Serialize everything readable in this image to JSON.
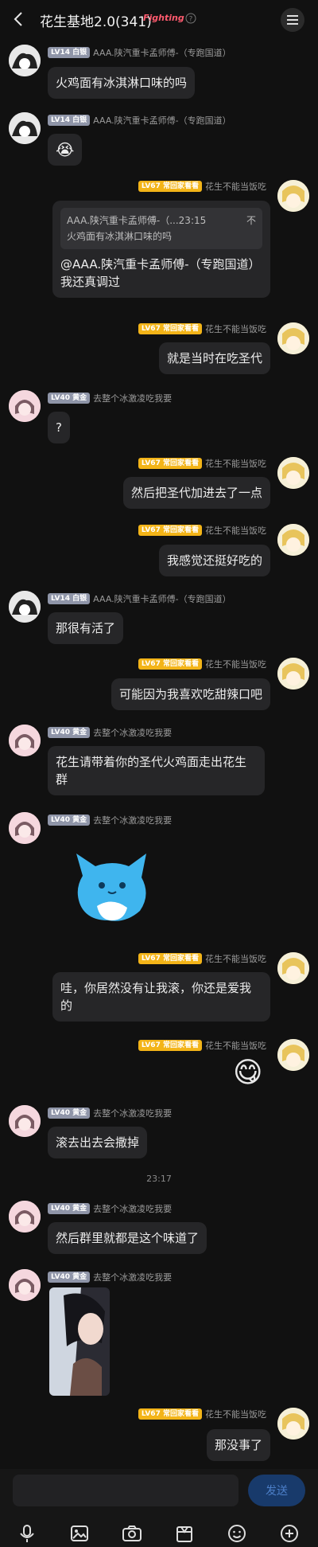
{
  "header": {
    "title": "花生基地2.0(341)",
    "tag": "Fighting"
  },
  "messages": [
    {
      "id": "m1",
      "side": "left",
      "level": "LV14",
      "rank": "白银",
      "nick": "AAA.陕汽重卡孟师傅-（专跑国道）",
      "text": "火鸡面有冰淇淋口味的吗"
    },
    {
      "id": "m2",
      "side": "left",
      "level": "LV14",
      "rank": "白银",
      "nick": "AAA.陕汽重卡孟师傅-（专跑国道）",
      "emoji": "😭"
    },
    {
      "id": "m3",
      "side": "right",
      "level": "LV67",
      "rank": "常回家看看",
      "nick": "花生不能当饭吃",
      "quote": {
        "head": "AAA.陕汽重卡孟师傅-（...23:15",
        "tail": "不",
        "body": "火鸡面有冰淇淋口味的吗"
      },
      "text": "@AAA.陕汽重卡孟师傅-（专跑国道） 我还真调过"
    },
    {
      "id": "m4",
      "side": "right",
      "level": "LV67",
      "rank": "常回家看看",
      "nick": "花生不能当饭吃",
      "text": "就是当时在吃圣代"
    },
    {
      "id": "m5",
      "side": "left",
      "level": "LV40",
      "rank": "黄金",
      "nick": "去整个冰激凌吃我要",
      "text": "?"
    },
    {
      "id": "m6",
      "side": "right",
      "level": "LV67",
      "rank": "常回家看看",
      "nick": "花生不能当饭吃",
      "text": "然后把圣代加进去了一点"
    },
    {
      "id": "m7",
      "side": "right",
      "level": "LV67",
      "rank": "常回家看看",
      "nick": "花生不能当饭吃",
      "text": "我感觉还挺好吃的"
    },
    {
      "id": "m8",
      "side": "left",
      "level": "LV14",
      "rank": "白银",
      "nick": "AAA.陕汽重卡孟师傅-（专跑国道）",
      "text": "那很有活了"
    },
    {
      "id": "m9",
      "side": "right",
      "level": "LV67",
      "rank": "常回家看看",
      "nick": "花生不能当饭吃",
      "text": "可能因为我喜欢吃甜辣口吧"
    },
    {
      "id": "m10",
      "side": "left",
      "level": "LV40",
      "rank": "黄金",
      "nick": "去整个冰激凌吃我要",
      "text": "花生请带着你的圣代火鸡面走出花生群"
    },
    {
      "id": "m11",
      "side": "left",
      "level": "LV40",
      "rank": "黄金",
      "nick": "去整个冰激凌吃我要",
      "sticker": "blue-cat-sticker"
    },
    {
      "id": "m12",
      "side": "right",
      "level": "LV67",
      "rank": "常回家看看",
      "nick": "花生不能当饭吃",
      "text": "哇，你居然没有让我滚，你还是爱我的"
    },
    {
      "id": "m13",
      "side": "right",
      "level": "LV67",
      "rank": "常回家看看",
      "nick": "花生不能当饭吃",
      "emoji": "😋"
    },
    {
      "id": "m14",
      "side": "left",
      "level": "LV40",
      "rank": "黄金",
      "nick": "去整个冰激凌吃我要",
      "text": "滚去出去会撒掉"
    },
    {
      "id": "m15",
      "side": "left",
      "level": "LV40",
      "rank": "黄金",
      "nick": "去整个冰激凌吃我要",
      "text": "然后群里就都是这个味道了"
    },
    {
      "id": "m16",
      "side": "left",
      "level": "LV40",
      "rank": "黄金",
      "nick": "去整个冰激凌吃我要",
      "image": "anime-girl-photo"
    },
    {
      "id": "m17",
      "side": "right",
      "level": "LV67",
      "rank": "常回家看看",
      "nick": "花生不能当饭吃",
      "text": "那没事了"
    }
  ],
  "timestamp": "23:17",
  "composer": {
    "send_label": "发送",
    "tools": [
      "mic-icon",
      "image-icon",
      "camera-icon",
      "gift-icon",
      "emoji-icon",
      "plus-icon"
    ]
  },
  "colors": {
    "background": "#111111",
    "bubble": "#262628",
    "badge_gold": "#f3b418",
    "send_bg": "#183a6b"
  }
}
